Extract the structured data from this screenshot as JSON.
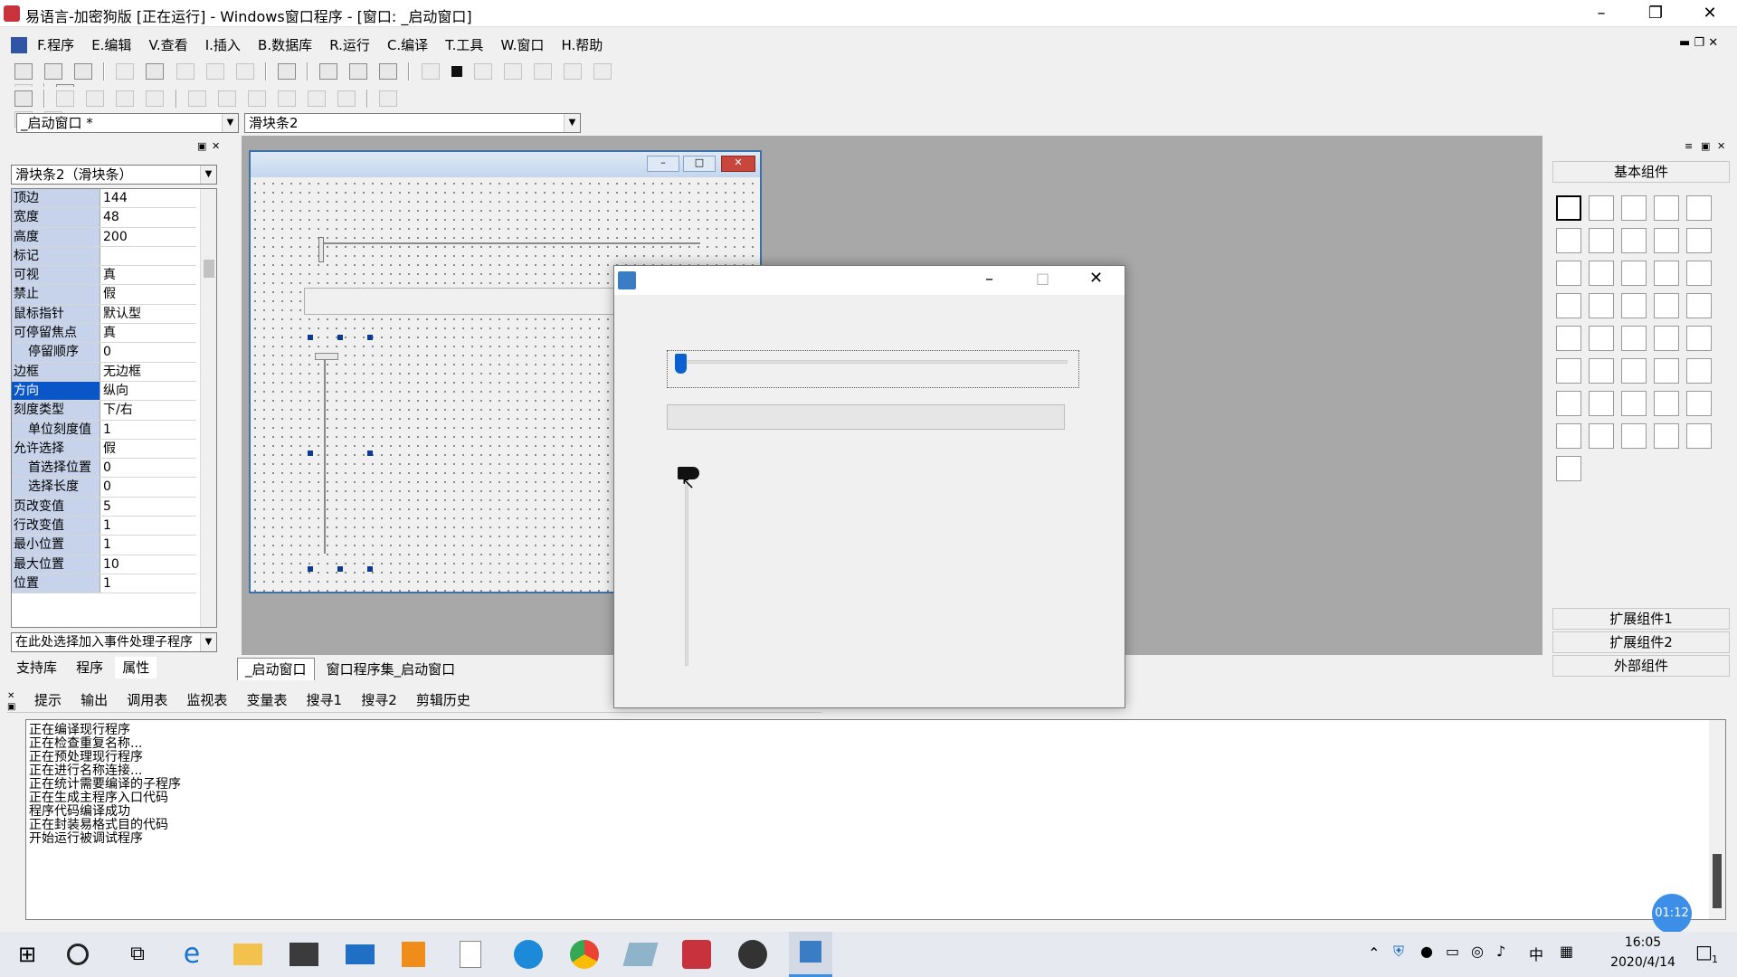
{
  "window": {
    "title": "易语言-加密狗版 [正在运行] - Windows窗口程序 - [窗口: _启动窗口]"
  },
  "menu": [
    "F.程序",
    "E.编辑",
    "V.查看",
    "I.插入",
    "B.数据库",
    "R.运行",
    "C.编译",
    "T.工具",
    "W.窗口",
    "H.帮助"
  ],
  "combos": {
    "window_select": "_启动窗口 *",
    "component_select": "滑块条2"
  },
  "property_panel": {
    "selector": "滑块条2（滑块条）",
    "rows": [
      {
        "name": "顶边",
        "value": "144"
      },
      {
        "name": "宽度",
        "value": "48"
      },
      {
        "name": "高度",
        "value": "200"
      },
      {
        "name": "标记",
        "value": ""
      },
      {
        "name": "可视",
        "value": "真"
      },
      {
        "name": "禁止",
        "value": "假"
      },
      {
        "name": "鼠标指针",
        "value": "默认型"
      },
      {
        "name": "可停留焦点",
        "value": "真"
      },
      {
        "name": "停留顺序",
        "value": "0"
      },
      {
        "name": "边框",
        "value": "无边框"
      },
      {
        "name": "方向",
        "value": "纵向"
      },
      {
        "name": "刻度类型",
        "value": "下/右"
      },
      {
        "name": "单位刻度值",
        "value": "1"
      },
      {
        "name": "允许选择",
        "value": "假"
      },
      {
        "name": "首选择位置",
        "value": "0"
      },
      {
        "name": "选择长度",
        "value": "0"
      },
      {
        "name": "页改变值",
        "value": "5"
      },
      {
        "name": "行改变值",
        "value": "1"
      },
      {
        "name": "最小位置",
        "value": "1"
      },
      {
        "name": "最大位置",
        "value": "10"
      },
      {
        "name": "位置",
        "value": "1"
      }
    ],
    "event_selector": "在此处选择加入事件处理子程序",
    "tabs": [
      "支持库",
      "程序",
      "属性"
    ]
  },
  "editor_tabs": [
    "_启动窗口",
    "窗口程序集_启动窗口"
  ],
  "right_panel": {
    "header": "基本组件",
    "buttons": [
      "扩展组件1",
      "扩展组件2",
      "外部组件"
    ]
  },
  "bottom_tabs": [
    "提示",
    "输出",
    "调用表",
    "监视表",
    "变量表",
    "搜寻1",
    "搜寻2",
    "剪辑历史"
  ],
  "output_lines": [
    "正在编译现行程序",
    "正在检查重复名称...",
    "正在预处理现行程序",
    "正在进行名称连接...",
    "正在统计需要编译的子程序",
    "正在生成主程序入口代码",
    "程序代码编译成功",
    "正在封装易格式目的代码",
    "开始运行被调试程序"
  ],
  "timer_badge": "01:12",
  "taskbar": {
    "ime": "中",
    "time": "16:05",
    "date": "2020/4/14",
    "notification_count": "1"
  }
}
